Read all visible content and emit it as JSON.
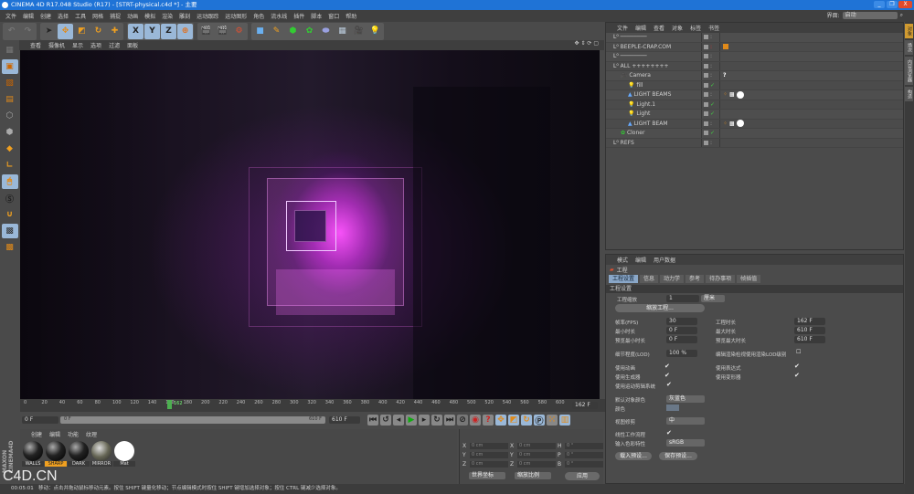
{
  "window": {
    "title": "CINEMA 4D R17.048 Studio (R17) - [STRT-physical.c4d *] - 主要",
    "minimize": "_",
    "restore": "❐",
    "close": "X"
  },
  "menu": [
    "文件",
    "编辑",
    "创建",
    "选择",
    "工具",
    "网格",
    "捕捉",
    "动画",
    "模拟",
    "渲染",
    "雕刻",
    "运动跟踪",
    "运动图形",
    "角色",
    "流水线",
    "插件",
    "脚本",
    "窗口",
    "帮助"
  ],
  "layout": {
    "label": "界面:",
    "value": "启动"
  },
  "toolbar": {
    "axes": [
      "X",
      "Y",
      "Z"
    ]
  },
  "viewport": {
    "menu": [
      "查看",
      "摄像机",
      "显示",
      "选项",
      "过滤",
      "面板"
    ]
  },
  "objects": {
    "menu": [
      "文件",
      "编辑",
      "查看",
      "对象",
      "标签",
      "书签"
    ],
    "rows": [
      {
        "name": "────────",
        "depth": 0
      },
      {
        "name": "BEEPLE-CRAP.COM",
        "depth": 0
      },
      {
        "name": "────────",
        "depth": 0
      },
      {
        "name": "ALL ++++++++",
        "depth": 0
      },
      {
        "name": "Camera",
        "depth": 1,
        "tag": "?"
      },
      {
        "name": "fill",
        "depth": 2,
        "check": true
      },
      {
        "name": "LIGHT BEAMS",
        "depth": 2
      },
      {
        "name": "Light.1",
        "depth": 2,
        "check": true
      },
      {
        "name": "Light",
        "depth": 2,
        "check": true
      },
      {
        "name": "LIGHT BEAM",
        "depth": 2
      },
      {
        "name": "Cloner",
        "depth": 1,
        "check": true
      },
      {
        "name": "REFS",
        "depth": 0
      }
    ]
  },
  "right_tabs": [
    "对象",
    "场次",
    "内容浏览器",
    "构造"
  ],
  "attributes": {
    "menu": [
      "模式",
      "编辑",
      "用户数据"
    ],
    "title": "工程",
    "tabs": [
      "工程设置",
      "信息",
      "动力学",
      "参考",
      "待办事项",
      "帧插值"
    ],
    "section": "工程设置",
    "scale_label": "工程缩放",
    "scale_value": "1",
    "scale_unit": "厘米",
    "scale_button": "缩放工程...",
    "fps_label": "帧率(FPS)",
    "fps": "30",
    "proj_len_label": "工程时长",
    "proj_len": "162 F",
    "min_label": "最小时长",
    "min": "0 F",
    "max_label": "最大时长",
    "max": "610 F",
    "pmin_label": "预览最小时长",
    "pmin": "0 F",
    "pmax_label": "预览最大时长",
    "pmax": "610 F",
    "lod_label": "细节程度(LOD)",
    "lod": "100 %",
    "lod_render_label": "编辑渲染检视使用渲染LOD级别",
    "use_anim": "使用动画",
    "use_expr": "使用表达式",
    "use_gen": "使用生成器",
    "use_deform": "使用变形器",
    "use_motion": "使用运动剪辑系统",
    "def_color_label": "默认对象颜色",
    "def_color": "灰蓝色",
    "color_label": "颜色",
    "clip_label": "视图修剪",
    "clip": "中",
    "linear_label": "线性工作流程",
    "input_color_label": "输入色彩特性",
    "input_color": "sRGB",
    "load_preset": "载入预设...",
    "save_preset": "保存预设..."
  },
  "timeline": {
    "ticks": [
      "0",
      "20",
      "40",
      "60",
      "80",
      "100",
      "120",
      "140",
      "160",
      "180",
      "200",
      "220",
      "240",
      "260",
      "280",
      "300",
      "320",
      "340",
      "360",
      "380",
      "400",
      "420",
      "440",
      "460",
      "480",
      "500",
      "520",
      "540",
      "560",
      "580",
      "600"
    ],
    "current": "162",
    "end": "162 F"
  },
  "transport": {
    "start": "0 F",
    "range_start": "0 F",
    "range_end": "610 F",
    "end": "610 F"
  },
  "materials": {
    "menu": [
      "创建",
      "编辑",
      "功能",
      "纹理"
    ],
    "items": [
      "WALLS",
      "SHARP",
      "DARK",
      "MIRROR",
      "Mat"
    ],
    "selected": "SHARP"
  },
  "coords": {
    "rows": [
      [
        "X",
        "0 cm",
        "X",
        "0 cm",
        "H",
        "0 °"
      ],
      [
        "Y",
        "0 cm",
        "Y",
        "0 cm",
        "P",
        "0 °"
      ],
      [
        "Z",
        "0 cm",
        "Z",
        "0 cm",
        "B",
        "0 °"
      ]
    ],
    "mode1": "世界坐标",
    "mode2": "缩放比例",
    "apply": "应用"
  },
  "status": {
    "time": "00:05:01",
    "text": "移动：点击并拖动鼠标移动元素。按住 SHIFT 键量化移动；节点编辑模式时按住 SHIFT 键增加选择对象；按住 CTRL 键减少选择对象。"
  },
  "watermark": {
    "brand": "MAXON CINEMA4D",
    "site": "C4D.CN"
  },
  "colors": {
    "titlebar": "#1f73d6",
    "accent": "#8aa7c8",
    "selected_material": "#f0a020",
    "glow": "#ff50ff"
  }
}
